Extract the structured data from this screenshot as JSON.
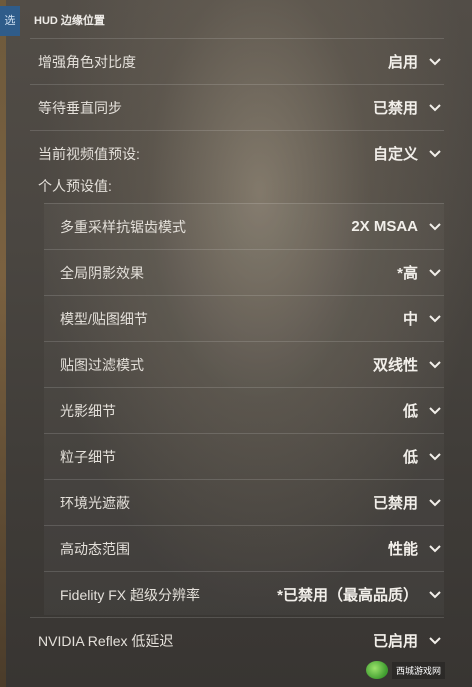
{
  "side_tab": {
    "label": "选项"
  },
  "header": {
    "title": "HUD 边缘位置"
  },
  "settings_top": [
    {
      "label": "增强角色对比度",
      "value": "启用"
    },
    {
      "label": "等待垂直同步",
      "value": "已禁用"
    },
    {
      "label": "当前视频值预设:",
      "value": "自定义"
    }
  ],
  "personal_preset_label": "个人预设值:",
  "settings_sub": [
    {
      "label": "多重采样抗锯齿模式",
      "value": "2X MSAA"
    },
    {
      "label": "全局阴影效果",
      "value": "*高"
    },
    {
      "label": "模型/贴图细节",
      "value": "中"
    },
    {
      "label": "贴图过滤模式",
      "value": "双线性"
    },
    {
      "label": "光影细节",
      "value": "低"
    },
    {
      "label": "粒子细节",
      "value": "低"
    },
    {
      "label": "环境光遮蔽",
      "value": "已禁用"
    },
    {
      "label": "高动态范围",
      "value": "性能"
    },
    {
      "label": "Fidelity FX 超级分辨率",
      "value": "*已禁用（最高品质）"
    }
  ],
  "settings_bottom": [
    {
      "label": "NVIDIA Reflex 低延迟",
      "value": "已启用"
    }
  ],
  "watermark": {
    "text": "西城游戏网"
  },
  "colors": {
    "side_tab_bg": "#2f5c8a",
    "text": "#e9e6e1"
  },
  "icons": {
    "dropdown": "chevron-down-icon"
  }
}
